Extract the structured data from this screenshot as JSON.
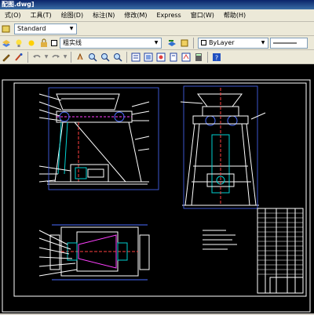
{
  "window": {
    "title": "配图.dwg]"
  },
  "menu": {
    "items": [
      "式(O)",
      "工具(T)",
      "绘图(D)",
      "标注(N)",
      "修改(M)",
      "Express",
      "窗口(W)",
      "帮助(H)"
    ]
  },
  "toolbar1": {
    "text_style": "Standard"
  },
  "toolbar2": {
    "layer_name": "粗实线",
    "linetype": "ByLayer"
  },
  "drawing": {
    "background": "#000000",
    "line_color": "#ffffff",
    "blue_color": "#4a6cff",
    "cyan_color": "#00d0d0",
    "magenta_color": "#ff40ff"
  }
}
